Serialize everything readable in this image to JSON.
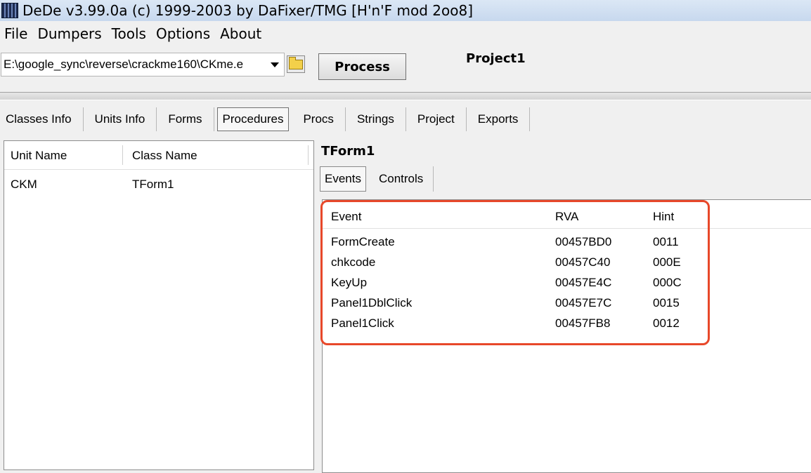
{
  "window": {
    "title": "DeDe v3.99.0a (c) 1999-2003 by DaFixer/TMG [H'n'F mod 2oo8]"
  },
  "menu": [
    "File",
    "Dumpers",
    "Tools",
    "Options",
    "About"
  ],
  "toolbar": {
    "path_value": "E:\\google_sync\\reverse\\crackme160\\CKme.e",
    "process_label": "Process",
    "project_name": "Project1"
  },
  "tabs": [
    "Classes Info",
    "Units Info",
    "Forms",
    "Procedures",
    "Procs",
    "Strings",
    "Project",
    "Exports"
  ],
  "active_tab": "Procedures",
  "units_table": {
    "headers": [
      "Unit Name",
      "Class Name"
    ],
    "rows": [
      [
        "CKM",
        "TForm1"
      ]
    ]
  },
  "form_panel": {
    "title": "TForm1",
    "subtabs": [
      "Events",
      "Controls"
    ],
    "active_subtab": "Events"
  },
  "events_table": {
    "headers": [
      "Event",
      "RVA",
      "Hint"
    ],
    "rows": [
      [
        "FormCreate",
        "00457BD0",
        "0011"
      ],
      [
        "chkcode",
        "00457C40",
        "000E"
      ],
      [
        "KeyUp",
        "00457E4C",
        "000C"
      ],
      [
        "Panel1DblClick",
        "00457E7C",
        "0015"
      ],
      [
        "Panel1Click",
        "00457FB8",
        "0012"
      ]
    ]
  },
  "colors": {
    "highlight": "#e8482a"
  }
}
